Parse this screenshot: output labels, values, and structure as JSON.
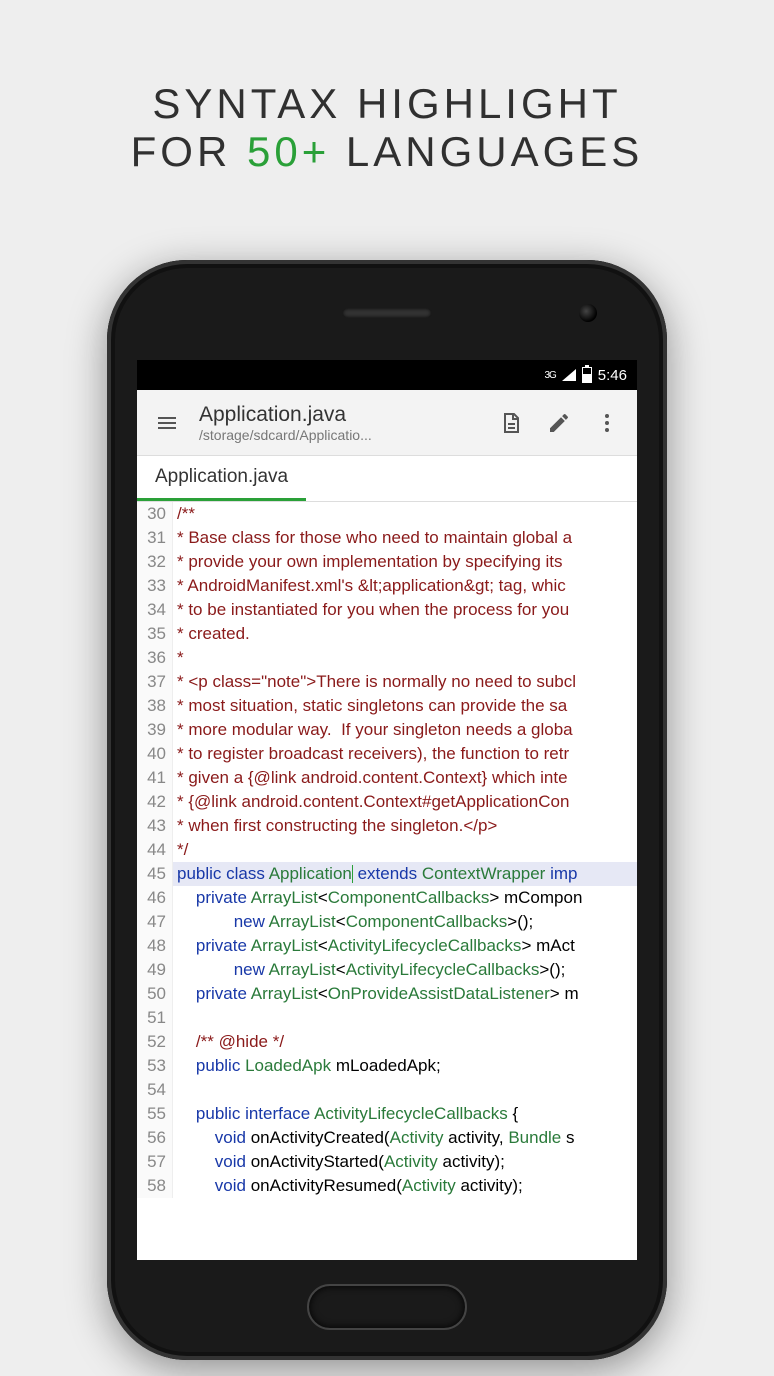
{
  "hero": {
    "line1_a": "SYNTAX HIGHLIGHT",
    "line2_a": "FOR ",
    "line2_b": "50+",
    "line2_c": " LANGUAGES"
  },
  "statusbar": {
    "network": "3G",
    "time": "5:46"
  },
  "toolbar": {
    "title": "Application.java",
    "subtitle": "/storage/sdcard/Applicatio..."
  },
  "tab": {
    "label": "Application.java"
  },
  "lines": [
    {
      "n": 30,
      "html": "<span class='cm'>/**</span>"
    },
    {
      "n": 31,
      "html": "<span class='cm'> * Base class for those who need to maintain global a</span>"
    },
    {
      "n": 32,
      "html": "<span class='cm'> * provide your own implementation by specifying its </span>"
    },
    {
      "n": 33,
      "html": "<span class='cm'> * AndroidManifest.xml's &amp;lt;application&amp;gt; tag, whic</span>"
    },
    {
      "n": 34,
      "html": "<span class='cm'> * to be instantiated for you when the process for you</span>"
    },
    {
      "n": 35,
      "html": "<span class='cm'> * created.</span>"
    },
    {
      "n": 36,
      "html": "<span class='cm'> *</span>"
    },
    {
      "n": 37,
      "html": "<span class='cm'> * &lt;p class=\"note\"&gt;There is normally no need to subcl</span>"
    },
    {
      "n": 38,
      "html": "<span class='cm'> * most situation, static singletons can provide the sa</span>"
    },
    {
      "n": 39,
      "html": "<span class='cm'> * more modular way.&nbsp; If your singleton needs a globa</span>"
    },
    {
      "n": 40,
      "html": "<span class='cm'> * to register broadcast receivers), the function to retr</span>"
    },
    {
      "n": 41,
      "html": "<span class='cm'> * given a {@link android.content.Context} which inte</span>"
    },
    {
      "n": 42,
      "html": "<span class='cm'> * {@link android.content.Context#getApplicationCon</span>"
    },
    {
      "n": 43,
      "html": "<span class='cm'> * when first constructing the singleton.&lt;/p&gt;</span>"
    },
    {
      "n": 44,
      "html": "<span class='cm'> */</span>"
    },
    {
      "n": 45,
      "current": true,
      "html": "<span class='kw'>public</span> <span class='kw'>class</span> <span class='ty'>Application</span><span class='caret'></span> <span class='kw'>extends</span> <span class='ty'>ContextWrapper</span> <span class='kw'>imp</span>"
    },
    {
      "n": 46,
      "html": "&nbsp;&nbsp;&nbsp;&nbsp;<span class='kw'>private</span> <span class='ty'>ArrayList</span>&lt;<span class='ty'>ComponentCallbacks</span>&gt; mCompon"
    },
    {
      "n": 47,
      "html": "&nbsp;&nbsp;&nbsp;&nbsp;&nbsp;&nbsp;&nbsp;&nbsp;&nbsp;&nbsp;&nbsp;&nbsp;<span class='kw'>new</span> <span class='ty'>ArrayList</span>&lt;<span class='ty'>ComponentCallbacks</span>&gt;();"
    },
    {
      "n": 48,
      "html": "&nbsp;&nbsp;&nbsp;&nbsp;<span class='kw'>private</span> <span class='ty'>ArrayList</span>&lt;<span class='ty'>ActivityLifecycleCallbacks</span>&gt; mAct"
    },
    {
      "n": 49,
      "html": "&nbsp;&nbsp;&nbsp;&nbsp;&nbsp;&nbsp;&nbsp;&nbsp;&nbsp;&nbsp;&nbsp;&nbsp;<span class='kw'>new</span> <span class='ty'>ArrayList</span>&lt;<span class='ty'>ActivityLifecycleCallbacks</span>&gt;();"
    },
    {
      "n": 50,
      "html": "&nbsp;&nbsp;&nbsp;&nbsp;<span class='kw'>private</span> <span class='ty'>ArrayList</span>&lt;<span class='ty'>OnProvideAssistDataListener</span>&gt; m"
    },
    {
      "n": 51,
      "html": ""
    },
    {
      "n": 52,
      "html": "&nbsp;&nbsp;&nbsp;&nbsp;<span class='cm'>/** @hide */</span>"
    },
    {
      "n": 53,
      "html": "&nbsp;&nbsp;&nbsp;&nbsp;<span class='kw'>public</span> <span class='ty'>LoadedApk</span> mLoadedApk;"
    },
    {
      "n": 54,
      "html": ""
    },
    {
      "n": 55,
      "html": "&nbsp;&nbsp;&nbsp;&nbsp;<span class='kw'>public</span> <span class='kw'>interface</span> <span class='ty'>ActivityLifecycleCallbacks</span> {"
    },
    {
      "n": 56,
      "html": "&nbsp;&nbsp;&nbsp;&nbsp;&nbsp;&nbsp;&nbsp;&nbsp;<span class='kw'>void</span> onActivityCreated(<span class='ty'>Activity</span> activity, <span class='ty'>Bundle</span> s"
    },
    {
      "n": 57,
      "html": "&nbsp;&nbsp;&nbsp;&nbsp;&nbsp;&nbsp;&nbsp;&nbsp;<span class='kw'>void</span> onActivityStarted(<span class='ty'>Activity</span> activity);"
    },
    {
      "n": 58,
      "html": "&nbsp;&nbsp;&nbsp;&nbsp;&nbsp;&nbsp;&nbsp;&nbsp;<span class='kw'>void</span> onActivityResumed(<span class='ty'>Activity</span> activity);"
    }
  ]
}
